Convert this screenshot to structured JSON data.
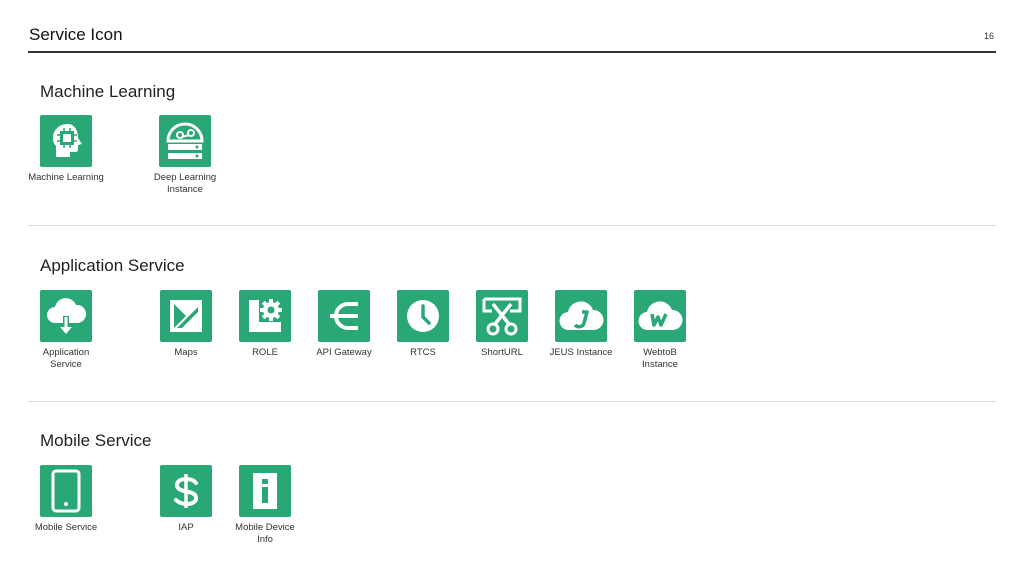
{
  "page": {
    "title": "Service Icon",
    "number": "16"
  },
  "sections": {
    "machine_learning": {
      "title": "Machine Learning",
      "items": [
        {
          "label": "Machine Learning",
          "icon": "brain-chip-icon"
        },
        {
          "label": "Deep Learning\nInstance",
          "icon": "deep-learning-server-icon"
        }
      ]
    },
    "application_service": {
      "title": "Application Service",
      "items": [
        {
          "label": "Application\nService",
          "icon": "cloud-download-icon"
        },
        {
          "label": "Maps",
          "icon": "map-icon"
        },
        {
          "label": "ROLE",
          "icon": "role-gear-icon"
        },
        {
          "label": "API Gateway",
          "icon": "api-gateway-icon"
        },
        {
          "label": "RTCS",
          "icon": "clock-icon"
        },
        {
          "label": "ShortURL",
          "icon": "scissors-icon"
        },
        {
          "label": "JEUS Instance",
          "icon": "jeus-cloud-icon"
        },
        {
          "label": "WebtoB\nInstance",
          "icon": "webtob-cloud-icon"
        }
      ]
    },
    "mobile_service": {
      "title": "Mobile Service",
      "items": [
        {
          "label": "Mobile Service",
          "icon": "smartphone-icon"
        },
        {
          "label": "IAP",
          "icon": "dollar-icon"
        },
        {
          "label": "Mobile Device\nInfo",
          "icon": "info-icon"
        }
      ]
    }
  },
  "colors": {
    "icon_background": "#29a875",
    "icon_foreground": "#ffffff"
  }
}
